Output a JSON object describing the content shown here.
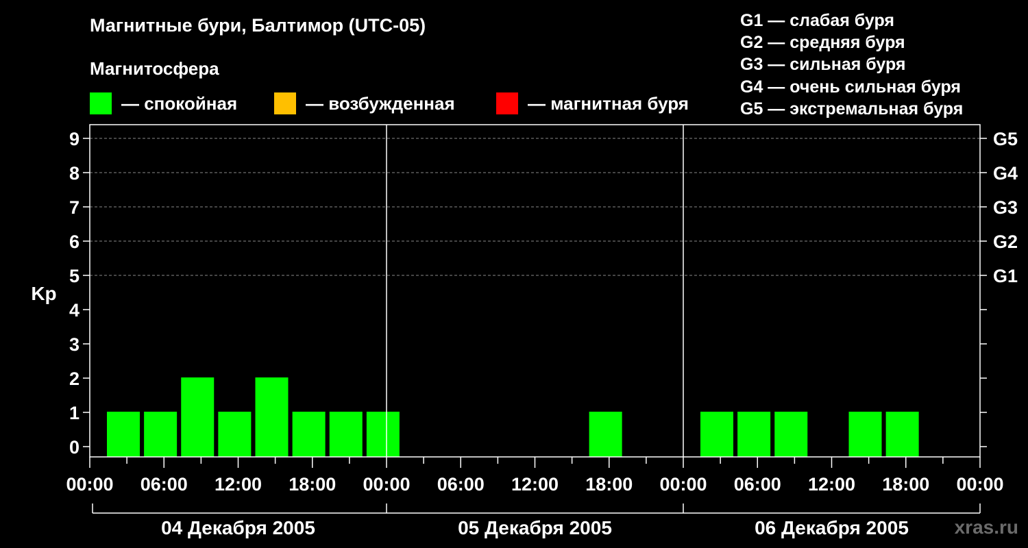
{
  "header": {
    "title": "Магнитные бури, Балтимор (UTC-05)",
    "subtitle": "Магнитосфера"
  },
  "legend": [
    {
      "label": "— спокойная",
      "color": "#00ff00"
    },
    {
      "label": "— возбужденная",
      "color": "#ffbf00"
    },
    {
      "label": "— магнитная буря",
      "color": "#ff0000"
    }
  ],
  "storm_scale": [
    "G1 — слабая буря",
    "G2 — средняя буря",
    "G3 — сильная буря",
    "G4 — очень сильная буря",
    "G5 — экстремальная буря"
  ],
  "watermark": "xras.ru",
  "chart_data": {
    "type": "bar",
    "ylabel": "Kp",
    "ylim": [
      0,
      9
    ],
    "yticks": [
      "0",
      "1",
      "2",
      "3",
      "4",
      "5",
      "6",
      "7",
      "8",
      "9"
    ],
    "right_axis_labels": [
      {
        "kp": 5,
        "label": "G1"
      },
      {
        "kp": 6,
        "label": "G2"
      },
      {
        "kp": 7,
        "label": "G3"
      },
      {
        "kp": 8,
        "label": "G4"
      },
      {
        "kp": 9,
        "label": "G5"
      }
    ],
    "grid": "dashed horizontal at Kp 5–9",
    "x_tick_labels": [
      "00:00",
      "06:00",
      "12:00",
      "18:00",
      "00:00",
      "06:00",
      "12:00",
      "18:00",
      "00:00",
      "06:00",
      "12:00",
      "18:00",
      "00:00"
    ],
    "days": [
      "04 Декабря 2005",
      "05 Декабря 2005",
      "06 Декабря 2005"
    ],
    "categories": [
      "04 Декабря 2005 00–03",
      "04 Декабря 2005 03–06",
      "04 Декабря 2005 06–09",
      "04 Декабря 2005 09–12",
      "04 Декабря 2005 12–15",
      "04 Декабря 2005 15–18",
      "04 Декабря 2005 18–21",
      "04 Декабря 2005 21–24",
      "05 Декабря 2005 00–03",
      "05 Декабря 2005 03–06",
      "05 Декабря 2005 06–09",
      "05 Декабря 2005 09–12",
      "05 Декабря 2005 12–15",
      "05 Декабря 2005 15–18",
      "05 Декабря 2005 18–21",
      "05 Декабря 2005 21–24",
      "06 Декабря 2005 00–03",
      "06 Декабря 2005 03–06",
      "06 Декабря 2005 06–09",
      "06 Декабря 2005 09–12",
      "06 Декабря 2005 12–15",
      "06 Декабря 2005 15–18",
      "06 Декабря 2005 18–21",
      "06 Декабря 2005 21–24"
    ],
    "values": [
      1,
      1,
      2,
      1,
      2,
      1,
      1,
      1,
      null,
      null,
      null,
      null,
      null,
      1,
      null,
      null,
      1,
      1,
      1,
      null,
      1,
      1,
      null,
      null
    ],
    "bar_color": "#00ff00"
  }
}
